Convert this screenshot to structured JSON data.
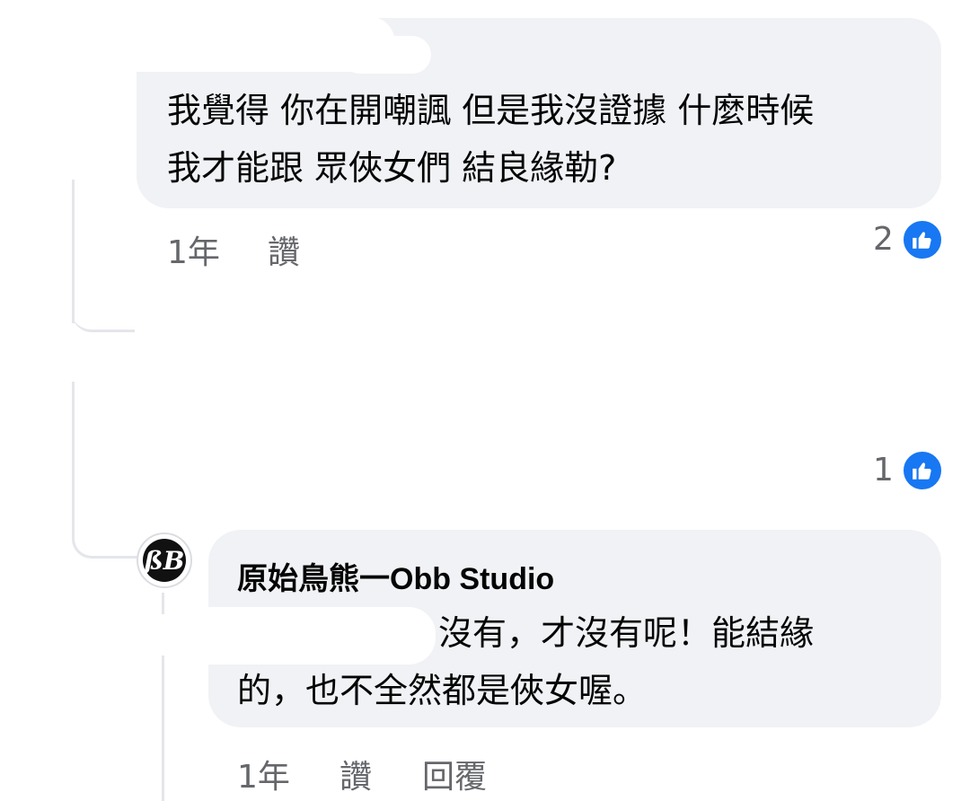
{
  "comment1": {
    "line1": "我覺得 你在開嘲諷 但是我沒證據  什麼時候",
    "line2": "我才能跟 眾俠女們 結良緣勒?",
    "time": "1年",
    "like_action": "讚",
    "like_count": "2"
  },
  "comment2": {
    "like_count": "1"
  },
  "reply": {
    "avatar_text": "ßB",
    "author": "原始鳥熊一Obb Studio",
    "line1": "沒有，才沒有呢！能結緣",
    "line2": "的，也不全然都是俠女喔。",
    "time": "1年",
    "like_action": "讚",
    "reply_action": "回覆"
  },
  "colors": {
    "bubble": "#f0f2f5",
    "meta_text": "#65676b",
    "like_blue": "#1877f2",
    "thread_line": "#e4e6eb"
  }
}
